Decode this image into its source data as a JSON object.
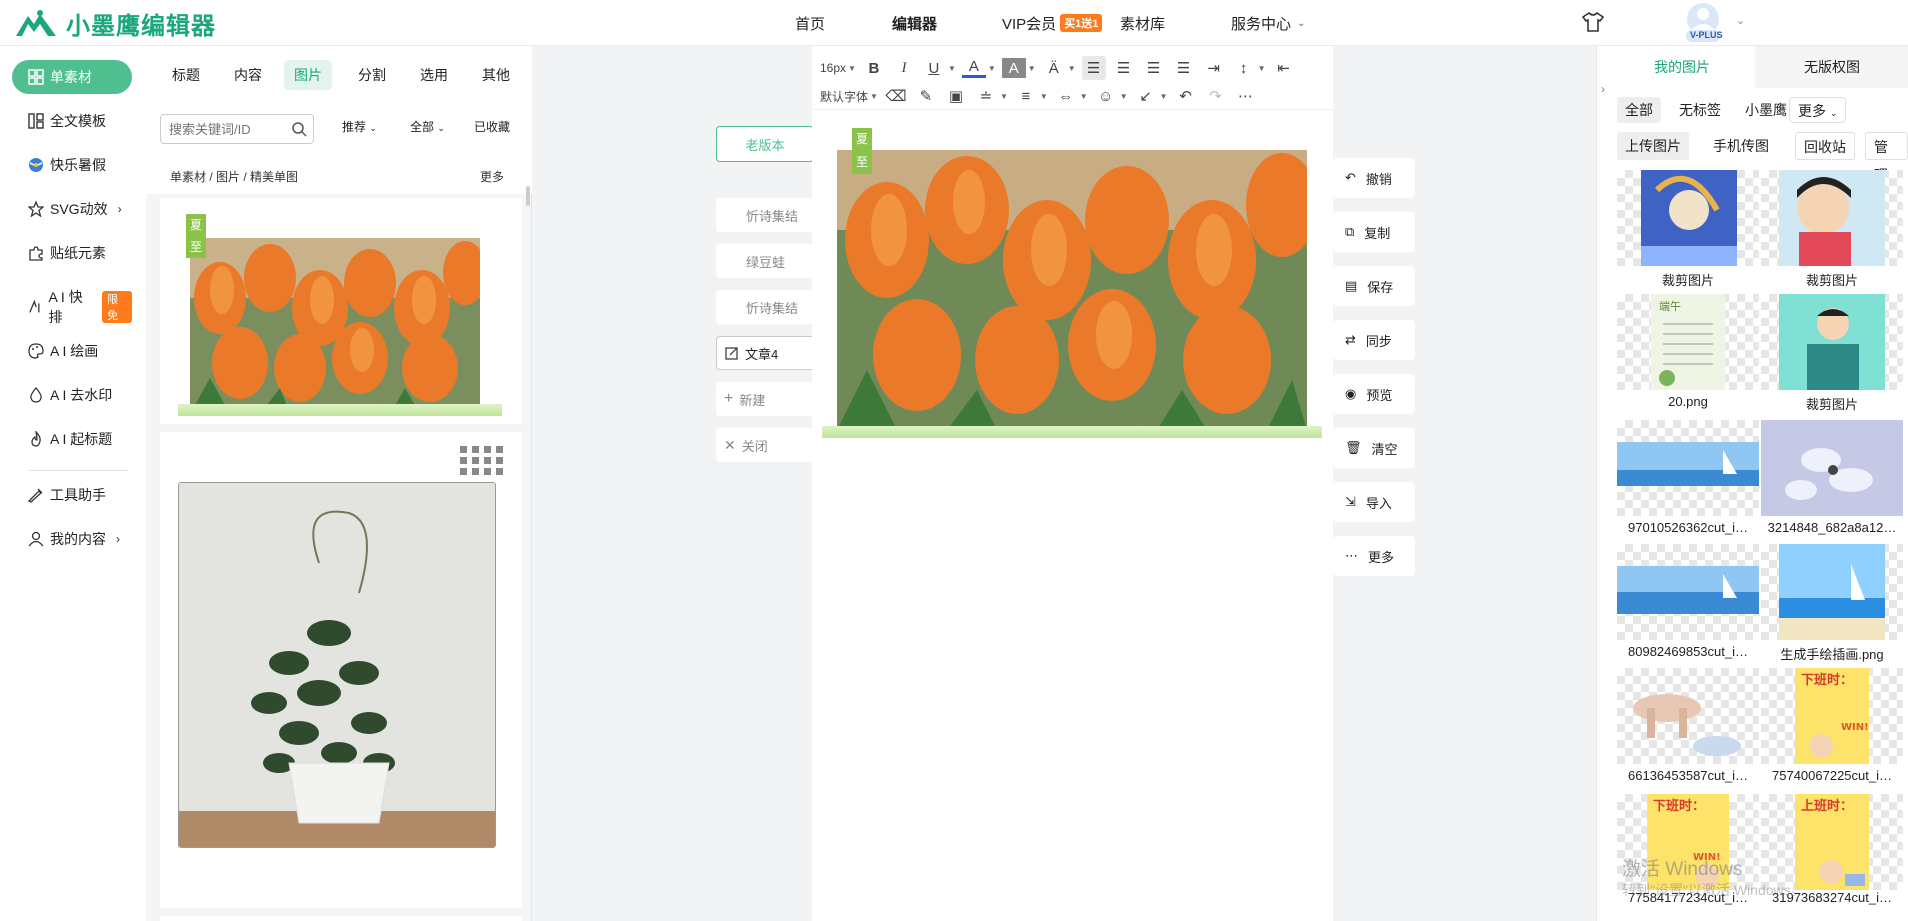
{
  "header": {
    "logo_text": "小墨鹰编辑器",
    "nav": [
      "首页",
      "编辑器",
      "VIP会员",
      "素材库",
      "服务中心"
    ],
    "vip_badge": "买1送1",
    "avatar_badge": "V-PLUS",
    "colors": {
      "brand": "#1aa77e",
      "accent": "#ff7a1a"
    }
  },
  "leftnav": {
    "items": [
      {
        "label": "单素材",
        "icon": "grid-icon"
      },
      {
        "label": "全文模板",
        "icon": "template-icon"
      },
      {
        "label": "快乐暑假",
        "icon": "ball-icon"
      },
      {
        "label": "SVG动效",
        "icon": "star-icon"
      },
      {
        "label": "贴纸元素",
        "icon": "puzzle-icon"
      },
      {
        "label": "A I 快排",
        "icon": "ai-icon",
        "badge": "限免"
      },
      {
        "label": "A I 绘画",
        "icon": "palette-icon"
      },
      {
        "label": "A I 去水印",
        "icon": "drop-icon"
      },
      {
        "label": "A I 起标题",
        "icon": "flame-icon"
      },
      {
        "label": "工具助手",
        "icon": "tool-icon"
      },
      {
        "label": "我的内容",
        "icon": "user-icon"
      }
    ]
  },
  "material": {
    "tabs": [
      "标题",
      "内容",
      "图片",
      "分割",
      "选用",
      "其他"
    ],
    "active_tab": "图片",
    "search_placeholder": "搜索关键词/ID",
    "filters": [
      "推荐",
      "全部",
      "已收藏"
    ],
    "breadcrumb": "单素材 / 图片 / 精美单图",
    "more": "更多",
    "tag_text": [
      "夏",
      "至"
    ]
  },
  "canvas": {
    "old_version": "老版本",
    "docs": [
      "忻诗集结",
      "绿豆蛙",
      "忻诗集结",
      "文章4"
    ],
    "new_doc": "新建",
    "close_doc": "关闭",
    "toolbar": {
      "font_size": "16px",
      "font_family": "默认字体"
    },
    "tag_text": [
      "夏",
      "至"
    ]
  },
  "side_actions": [
    "撤销",
    "复制",
    "保存",
    "同步",
    "预览",
    "清空",
    "导入",
    "更多"
  ],
  "rightpanel": {
    "tabs": [
      "我的图片",
      "无版权图"
    ],
    "filters": [
      "全部",
      "无标签",
      "小墨鹰",
      "更多"
    ],
    "buttons": [
      "上传图片",
      "手机传图",
      "回收站",
      "管理"
    ],
    "images": [
      {
        "caption": "裁剪图片"
      },
      {
        "caption": "裁剪图片"
      },
      {
        "caption": "20.png"
      },
      {
        "caption": "裁剪图片"
      },
      {
        "caption": "97010526362cut_i…"
      },
      {
        "caption": "3214848_682a8a12…"
      },
      {
        "caption": "80982469853cut_i…"
      },
      {
        "caption": "生成手绘插画.png"
      },
      {
        "caption": "66136453587cut_i…"
      },
      {
        "caption": "75740067225cut_i…"
      },
      {
        "caption": "77584177234cut_i…"
      },
      {
        "caption": "31973683274cut_i…"
      }
    ],
    "thumb_texts": {
      "offwork": "下班时：",
      "onwork": "上班时：",
      "win": "WIN!",
      "dragon": "端午"
    }
  },
  "watermark": {
    "line1": "激活 Windows",
    "line2": "转到\"设置\"以激活 Windows。"
  }
}
